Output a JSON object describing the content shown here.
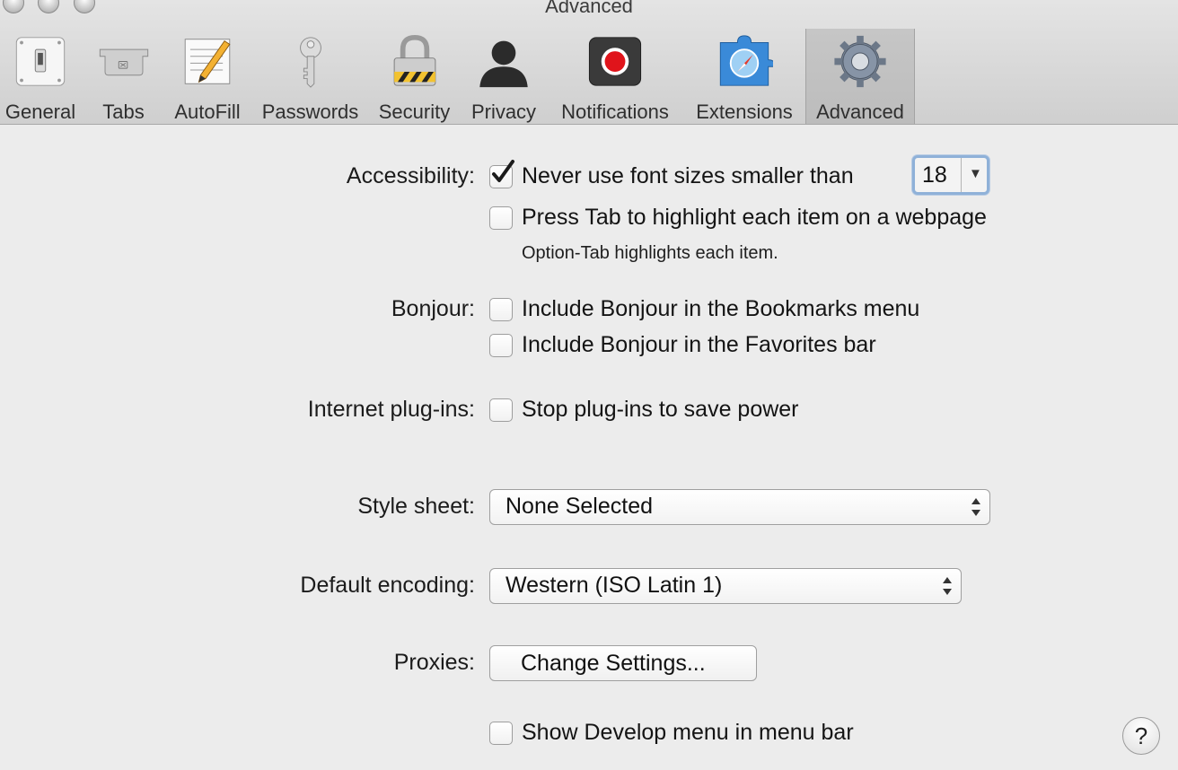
{
  "window": {
    "title": "Advanced"
  },
  "toolbar": {
    "items": [
      {
        "label": "General",
        "icon": "switch-icon"
      },
      {
        "label": "Tabs",
        "icon": "tabs-icon"
      },
      {
        "label": "AutoFill",
        "icon": "pencil-form-icon"
      },
      {
        "label": "Passwords",
        "icon": "key-icon"
      },
      {
        "label": "Security",
        "icon": "padlock-icon"
      },
      {
        "label": "Privacy",
        "icon": "silhouette-icon"
      },
      {
        "label": "Notifications",
        "icon": "record-icon"
      },
      {
        "label": "Extensions",
        "icon": "puzzle-compass-icon"
      },
      {
        "label": "Advanced",
        "icon": "gear-icon",
        "selected": true
      }
    ]
  },
  "settings": {
    "accessibility": {
      "label": "Accessibility:",
      "min_font": {
        "label": "Never use font sizes smaller than",
        "checked": true,
        "value": "18"
      },
      "press_tab": {
        "label": "Press Tab to highlight each item on a webpage",
        "checked": false
      },
      "note": "Option-Tab highlights each item."
    },
    "bonjour": {
      "label": "Bonjour:",
      "bookmarks_menu": {
        "label": "Include Bonjour in the Bookmarks menu",
        "checked": false
      },
      "favorites_bar": {
        "label": "Include Bonjour in the Favorites bar",
        "checked": false
      }
    },
    "plugins": {
      "label": "Internet plug-ins:",
      "stop_plugins": {
        "label": "Stop plug-ins to save power",
        "checked": false
      }
    },
    "style_sheet": {
      "label": "Style sheet:",
      "value": "None Selected"
    },
    "encoding": {
      "label": "Default encoding:",
      "value": "Western (ISO Latin 1)"
    },
    "proxies": {
      "label": "Proxies:",
      "button": "Change Settings..."
    },
    "develop": {
      "label": "Show Develop menu in menu bar",
      "checked": false
    }
  },
  "help": {
    "glyph": "?"
  },
  "colors": {
    "selection_ring": "#8fb1d8",
    "record_red": "#e0141b",
    "background": "#ececec"
  }
}
